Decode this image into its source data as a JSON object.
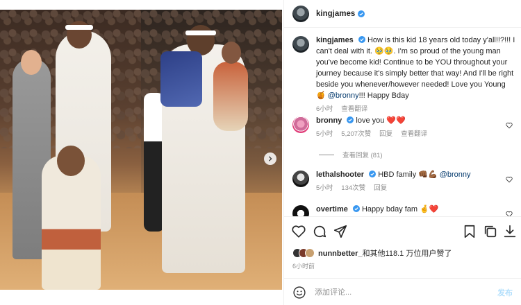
{
  "post": {
    "username": "kingjames",
    "caption": {
      "text": "How is this kid 18 years old today y'all!!?!!! I can't deal with it. 🥹🥹. I'm so proud of the young man you've become kid! Continue to be YOU throughout your journey because it's simply better that way! And I'll be right beside you whenever/however needed! Love you Young 🍯 ",
      "mention": "@bronny",
      "tail": "!!! Happy Bday"
    },
    "caption_time": "6小时",
    "caption_translate": "查看翻译"
  },
  "comments": [
    {
      "username": "bronny",
      "text": "love you ❤️❤️",
      "time": "5小时",
      "likes": "5,207次赞",
      "reply": "回复",
      "translate": "查看翻译",
      "replies_label": "查看回复 (81)"
    },
    {
      "username": "lethalshooter",
      "text": "HBD family 👊🏾💪🏾 ",
      "mention": "@bronny",
      "time": "5小时",
      "likes": "134次赞",
      "reply": "回复"
    },
    {
      "username": "overtime",
      "text": "Happy bday fam 🤞❤️"
    }
  ],
  "likes": {
    "text_user": "nunnbetter_",
    "text_rest": "和其他118.1 万位用户赞了"
  },
  "post_time": "6小时前",
  "composer": {
    "placeholder": "添加评论...",
    "post_label": "发布"
  },
  "icons": [
    "heart-icon",
    "comment-icon",
    "share-icon",
    "bookmark-icon",
    "copy-icon",
    "download-icon",
    "smiley-icon",
    "verified-icon",
    "chevron-right-icon"
  ]
}
